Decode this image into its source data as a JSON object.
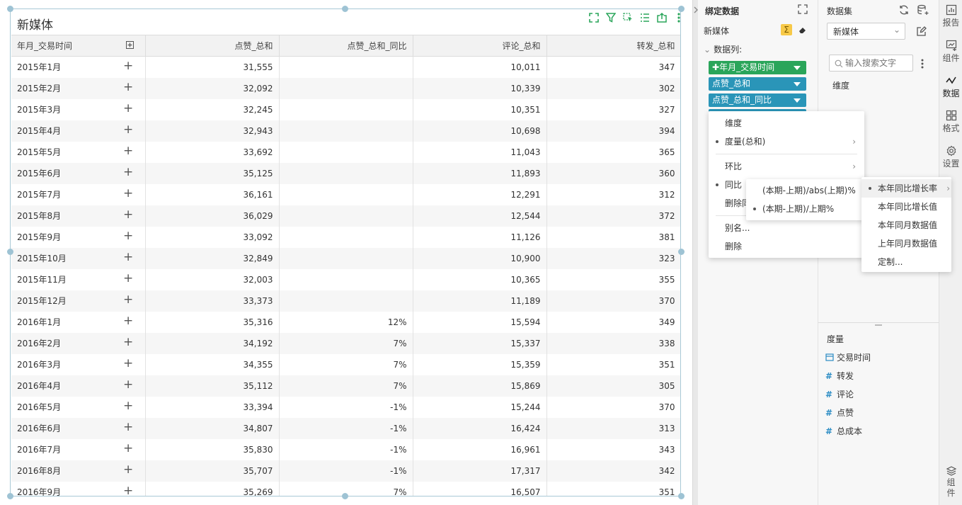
{
  "table": {
    "title": "新媒体",
    "columns": [
      "年月_交易时间",
      "点赞_总和",
      "点赞_总和_同比",
      "评论_总和",
      "转发_总和"
    ],
    "rows": [
      [
        "2015年1月",
        "31,555",
        "",
        "10,011",
        "347"
      ],
      [
        "2015年2月",
        "32,092",
        "",
        "10,339",
        "302"
      ],
      [
        "2015年3月",
        "32,245",
        "",
        "10,351",
        "327"
      ],
      [
        "2015年4月",
        "32,943",
        "",
        "10,698",
        "394"
      ],
      [
        "2015年5月",
        "33,692",
        "",
        "11,043",
        "365"
      ],
      [
        "2015年6月",
        "35,125",
        "",
        "11,893",
        "360"
      ],
      [
        "2015年7月",
        "36,161",
        "",
        "12,291",
        "312"
      ],
      [
        "2015年8月",
        "36,029",
        "",
        "12,544",
        "372"
      ],
      [
        "2015年9月",
        "33,092",
        "",
        "11,126",
        "381"
      ],
      [
        "2015年10月",
        "32,849",
        "",
        "10,900",
        "323"
      ],
      [
        "2015年11月",
        "32,003",
        "",
        "10,365",
        "355"
      ],
      [
        "2015年12月",
        "33,373",
        "",
        "11,189",
        "370"
      ],
      [
        "2016年1月",
        "35,316",
        "12%",
        "15,594",
        "349"
      ],
      [
        "2016年2月",
        "34,192",
        "7%",
        "15,337",
        "338"
      ],
      [
        "2016年3月",
        "34,355",
        "7%",
        "15,359",
        "351"
      ],
      [
        "2016年4月",
        "35,112",
        "7%",
        "15,869",
        "305"
      ],
      [
        "2016年5月",
        "33,394",
        "-1%",
        "15,244",
        "370"
      ],
      [
        "2016年6月",
        "34,807",
        "-1%",
        "16,424",
        "313"
      ],
      [
        "2016年7月",
        "35,830",
        "-1%",
        "16,961",
        "343"
      ],
      [
        "2016年8月",
        "35,707",
        "-1%",
        "17,317",
        "342"
      ],
      [
        "2016年9月",
        "35,269",
        "7%",
        "16,507",
        "351"
      ]
    ]
  },
  "bind_panel": {
    "title": "绑定数据",
    "dataset_name": "新媒体",
    "columns_label": "数据列:",
    "pills": [
      {
        "label": "年月_交易时间",
        "color": "#2aa55a"
      },
      {
        "label": "点赞_总和",
        "color": "#2a95b8"
      },
      {
        "label": "点赞_总和_同比",
        "color": "#2a95b8"
      }
    ]
  },
  "context_menu": {
    "items": [
      "维度",
      "度量(总和)",
      "环比",
      "同比",
      "删除同",
      "别名...",
      "删除"
    ]
  },
  "submenu_ratio": {
    "items": [
      "(本期-上期)/abs(上期)%",
      "(本期-上期)/上期%"
    ]
  },
  "submenu_yoy": {
    "items": [
      "本年同比增长率",
      "本年同比增长值",
      "本年同月数据值",
      "上年同月数据值",
      "定制..."
    ]
  },
  "dataset_panel": {
    "title": "数据集",
    "selected": "新媒体",
    "search_placeholder": "输入搜索文字",
    "dimension_label": "维度",
    "measure_label": "度量",
    "measures": [
      "交易时间",
      "转发",
      "评论",
      "点赞",
      "总成本"
    ]
  },
  "rail": {
    "items": [
      "报告",
      "组件",
      "数据",
      "格式",
      "设置"
    ],
    "bottom": "组件"
  }
}
